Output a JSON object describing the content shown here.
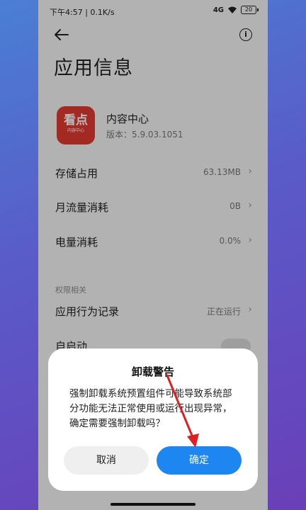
{
  "status_bar": {
    "time_speed": "下午4:57 | 0.1K/s",
    "signal": "4G",
    "battery": "20"
  },
  "page": {
    "title": "应用信息",
    "app_icon_text": "看点",
    "app_icon_subtext": "内容中心",
    "app_name": "内容中心",
    "app_version": "版本：5.9.03.1051"
  },
  "rows": [
    {
      "label": "存储占用",
      "value": "63.13MB"
    },
    {
      "label": "月流量消耗",
      "value": "0B"
    },
    {
      "label": "电量消耗",
      "value": "0.0%"
    }
  ],
  "permissions": {
    "section_label": "权限相关",
    "behavior_label": "应用行为记录",
    "behavior_value": "正在运行",
    "autostart_label": "自启动",
    "autostart_on": false
  },
  "dialog": {
    "title": "卸载警告",
    "message": "强制卸载系统预置组件可能导致系统部分功能无法正常使用或运行出现异常，确定需要强制卸载吗？",
    "cancel_label": "取消",
    "confirm_label": "确定"
  },
  "colors": {
    "accent": "#1e86f0",
    "annotation_arrow": "#e02020",
    "app_icon_bg": "#e03a2f"
  },
  "icons": {
    "back": "back-arrow-icon",
    "info": "info-icon",
    "chevron": "chevron-right-icon"
  }
}
